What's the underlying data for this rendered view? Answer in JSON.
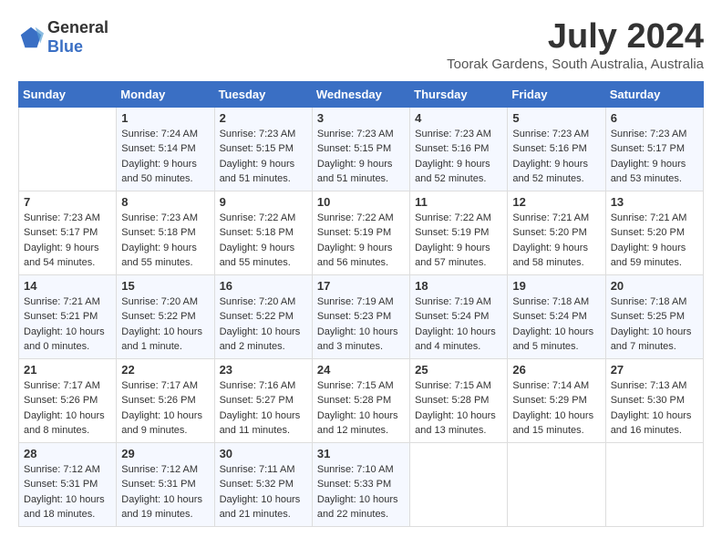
{
  "logo": {
    "general": "General",
    "blue": "Blue"
  },
  "title": {
    "month": "July 2024",
    "location": "Toorak Gardens, South Australia, Australia"
  },
  "headers": [
    "Sunday",
    "Monday",
    "Tuesday",
    "Wednesday",
    "Thursday",
    "Friday",
    "Saturday"
  ],
  "weeks": [
    [
      {
        "num": "",
        "sunrise": "",
        "sunset": "",
        "daylight": ""
      },
      {
        "num": "1",
        "sunrise": "Sunrise: 7:24 AM",
        "sunset": "Sunset: 5:14 PM",
        "daylight": "Daylight: 9 hours and 50 minutes."
      },
      {
        "num": "2",
        "sunrise": "Sunrise: 7:23 AM",
        "sunset": "Sunset: 5:15 PM",
        "daylight": "Daylight: 9 hours and 51 minutes."
      },
      {
        "num": "3",
        "sunrise": "Sunrise: 7:23 AM",
        "sunset": "Sunset: 5:15 PM",
        "daylight": "Daylight: 9 hours and 51 minutes."
      },
      {
        "num": "4",
        "sunrise": "Sunrise: 7:23 AM",
        "sunset": "Sunset: 5:16 PM",
        "daylight": "Daylight: 9 hours and 52 minutes."
      },
      {
        "num": "5",
        "sunrise": "Sunrise: 7:23 AM",
        "sunset": "Sunset: 5:16 PM",
        "daylight": "Daylight: 9 hours and 52 minutes."
      },
      {
        "num": "6",
        "sunrise": "Sunrise: 7:23 AM",
        "sunset": "Sunset: 5:17 PM",
        "daylight": "Daylight: 9 hours and 53 minutes."
      }
    ],
    [
      {
        "num": "7",
        "sunrise": "Sunrise: 7:23 AM",
        "sunset": "Sunset: 5:17 PM",
        "daylight": "Daylight: 9 hours and 54 minutes."
      },
      {
        "num": "8",
        "sunrise": "Sunrise: 7:23 AM",
        "sunset": "Sunset: 5:18 PM",
        "daylight": "Daylight: 9 hours and 55 minutes."
      },
      {
        "num": "9",
        "sunrise": "Sunrise: 7:22 AM",
        "sunset": "Sunset: 5:18 PM",
        "daylight": "Daylight: 9 hours and 55 minutes."
      },
      {
        "num": "10",
        "sunrise": "Sunrise: 7:22 AM",
        "sunset": "Sunset: 5:19 PM",
        "daylight": "Daylight: 9 hours and 56 minutes."
      },
      {
        "num": "11",
        "sunrise": "Sunrise: 7:22 AM",
        "sunset": "Sunset: 5:19 PM",
        "daylight": "Daylight: 9 hours and 57 minutes."
      },
      {
        "num": "12",
        "sunrise": "Sunrise: 7:21 AM",
        "sunset": "Sunset: 5:20 PM",
        "daylight": "Daylight: 9 hours and 58 minutes."
      },
      {
        "num": "13",
        "sunrise": "Sunrise: 7:21 AM",
        "sunset": "Sunset: 5:20 PM",
        "daylight": "Daylight: 9 hours and 59 minutes."
      }
    ],
    [
      {
        "num": "14",
        "sunrise": "Sunrise: 7:21 AM",
        "sunset": "Sunset: 5:21 PM",
        "daylight": "Daylight: 10 hours and 0 minutes."
      },
      {
        "num": "15",
        "sunrise": "Sunrise: 7:20 AM",
        "sunset": "Sunset: 5:22 PM",
        "daylight": "Daylight: 10 hours and 1 minute."
      },
      {
        "num": "16",
        "sunrise": "Sunrise: 7:20 AM",
        "sunset": "Sunset: 5:22 PM",
        "daylight": "Daylight: 10 hours and 2 minutes."
      },
      {
        "num": "17",
        "sunrise": "Sunrise: 7:19 AM",
        "sunset": "Sunset: 5:23 PM",
        "daylight": "Daylight: 10 hours and 3 minutes."
      },
      {
        "num": "18",
        "sunrise": "Sunrise: 7:19 AM",
        "sunset": "Sunset: 5:24 PM",
        "daylight": "Daylight: 10 hours and 4 minutes."
      },
      {
        "num": "19",
        "sunrise": "Sunrise: 7:18 AM",
        "sunset": "Sunset: 5:24 PM",
        "daylight": "Daylight: 10 hours and 5 minutes."
      },
      {
        "num": "20",
        "sunrise": "Sunrise: 7:18 AM",
        "sunset": "Sunset: 5:25 PM",
        "daylight": "Daylight: 10 hours and 7 minutes."
      }
    ],
    [
      {
        "num": "21",
        "sunrise": "Sunrise: 7:17 AM",
        "sunset": "Sunset: 5:26 PM",
        "daylight": "Daylight: 10 hours and 8 minutes."
      },
      {
        "num": "22",
        "sunrise": "Sunrise: 7:17 AM",
        "sunset": "Sunset: 5:26 PM",
        "daylight": "Daylight: 10 hours and 9 minutes."
      },
      {
        "num": "23",
        "sunrise": "Sunrise: 7:16 AM",
        "sunset": "Sunset: 5:27 PM",
        "daylight": "Daylight: 10 hours and 11 minutes."
      },
      {
        "num": "24",
        "sunrise": "Sunrise: 7:15 AM",
        "sunset": "Sunset: 5:28 PM",
        "daylight": "Daylight: 10 hours and 12 minutes."
      },
      {
        "num": "25",
        "sunrise": "Sunrise: 7:15 AM",
        "sunset": "Sunset: 5:28 PM",
        "daylight": "Daylight: 10 hours and 13 minutes."
      },
      {
        "num": "26",
        "sunrise": "Sunrise: 7:14 AM",
        "sunset": "Sunset: 5:29 PM",
        "daylight": "Daylight: 10 hours and 15 minutes."
      },
      {
        "num": "27",
        "sunrise": "Sunrise: 7:13 AM",
        "sunset": "Sunset: 5:30 PM",
        "daylight": "Daylight: 10 hours and 16 minutes."
      }
    ],
    [
      {
        "num": "28",
        "sunrise": "Sunrise: 7:12 AM",
        "sunset": "Sunset: 5:31 PM",
        "daylight": "Daylight: 10 hours and 18 minutes."
      },
      {
        "num": "29",
        "sunrise": "Sunrise: 7:12 AM",
        "sunset": "Sunset: 5:31 PM",
        "daylight": "Daylight: 10 hours and 19 minutes."
      },
      {
        "num": "30",
        "sunrise": "Sunrise: 7:11 AM",
        "sunset": "Sunset: 5:32 PM",
        "daylight": "Daylight: 10 hours and 21 minutes."
      },
      {
        "num": "31",
        "sunrise": "Sunrise: 7:10 AM",
        "sunset": "Sunset: 5:33 PM",
        "daylight": "Daylight: 10 hours and 22 minutes."
      },
      {
        "num": "",
        "sunrise": "",
        "sunset": "",
        "daylight": ""
      },
      {
        "num": "",
        "sunrise": "",
        "sunset": "",
        "daylight": ""
      },
      {
        "num": "",
        "sunrise": "",
        "sunset": "",
        "daylight": ""
      }
    ]
  ]
}
